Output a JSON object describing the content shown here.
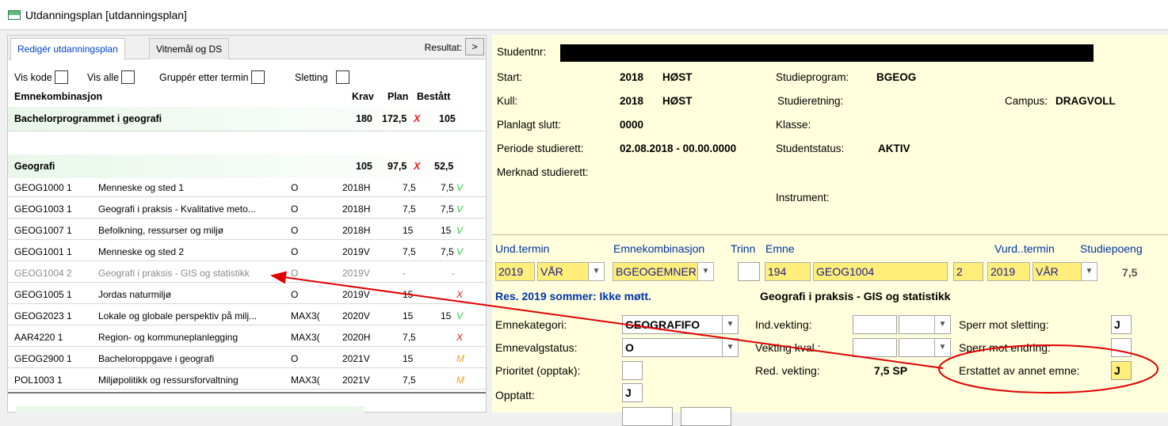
{
  "window": {
    "title": "Utdanningsplan  [utdanningsplan]"
  },
  "tabs": [
    {
      "label": "Redigér utdanningsplan"
    },
    {
      "label": "Vitnemål og DS"
    }
  ],
  "result": {
    "label": "Resultat:",
    "button": ">"
  },
  "checkboxes": [
    {
      "label": "Vis kode"
    },
    {
      "label": "Vis alle"
    },
    {
      "label": "Gruppér etter termin"
    },
    {
      "label": "Sletting"
    }
  ],
  "columns": {
    "name": "Emnekombinasjon",
    "krav": "Krav",
    "plan": "Plan",
    "bestatt": "Bestått"
  },
  "groups": [
    {
      "name": "Bachelorprogrammet i geografi",
      "krav": "180",
      "plan": "172,5",
      "mark": "X",
      "bestatt": "105"
    },
    {
      "name": "Geografi",
      "krav": "105",
      "plan": "97,5",
      "mark": "X",
      "bestatt": "52,5"
    }
  ],
  "rows": [
    {
      "code": "GEOG1000 1",
      "name": "Menneske og sted 1",
      "type": "O",
      "term": "2018H",
      "sp": "7,5",
      "res": "7,5",
      "mark": "V"
    },
    {
      "code": "GEOG1003 1",
      "name": "Geografi i praksis - Kvalitative meto...",
      "type": "O",
      "term": "2018H",
      "sp": "7,5",
      "res": "7,5",
      "mark": "V"
    },
    {
      "code": "GEOG1007 1",
      "name": "Befolkning, ressurser og miljø",
      "type": "O",
      "term": "2018H",
      "sp": "15",
      "res": "15",
      "mark": "V"
    },
    {
      "code": "GEOG1001 1",
      "name": "Menneske og sted 2",
      "type": "O",
      "term": "2019V",
      "sp": "7,5",
      "res": "7,5",
      "mark": "V"
    },
    {
      "code": "GEOG1004 2",
      "name": "Geografi i praksis - GIS og statistikk",
      "type": "O",
      "term": "2019V",
      "sp": "-",
      "res": "-",
      "mark": ""
    },
    {
      "code": "GEOG1005 1",
      "name": "Jordas naturmiljø",
      "type": "O",
      "term": "2019V",
      "sp": "15",
      "res": "",
      "mark": "X"
    },
    {
      "code": "GEOG2023 1",
      "name": "Lokale og globale perspektiv på milj...",
      "type": "MAX3(",
      "term": "2020V",
      "sp": "15",
      "res": "15",
      "mark": "V"
    },
    {
      "code": "AAR4220 1",
      "name": "Region- og kommuneplanlegging",
      "type": "MAX3(",
      "term": "2020H",
      "sp": "7,5",
      "res": "",
      "mark": "X"
    },
    {
      "code": "GEOG2900 1",
      "name": "Bacheloroppgave i geografi",
      "type": "O",
      "term": "2021V",
      "sp": "15",
      "res": "",
      "mark": "M"
    },
    {
      "code": "POL1003 1",
      "name": "Miljøpolitikk og ressursforvaltning",
      "type": "MAX3(",
      "term": "2021V",
      "sp": "7,5",
      "res": "",
      "mark": "M"
    }
  ],
  "student": {
    "studentnr_label": "Studentnr:",
    "start_label": "Start:",
    "start_year": "2018",
    "start_term": "HØST",
    "kull_label": "Kull:",
    "kull_year": "2018",
    "kull_term": "HØST",
    "slutt_label": "Planlagt slutt:",
    "slutt_value": "0000",
    "periode_label": "Periode studierett:",
    "periode_value": "02.08.2018 - 00.00.0000",
    "merknad_label": "Merknad studierett:",
    "program_label": "Studieprogram:",
    "program_value": "BGEOG",
    "retning_label": "Studieretning:",
    "campus_label": "Campus:",
    "campus_value": "DRAGVOLL",
    "klasse_label": "Klasse:",
    "status_label": "Studentstatus:",
    "status_value": "AKTIV",
    "instrument_label": "Instrument:"
  },
  "detail": {
    "und_termin_label": "Und.termin",
    "emnekomb_label": "Emnekombinasjon",
    "trinn_label": "Trinn",
    "emne_label": "Emne",
    "vurd_label": "Vurd..termin",
    "sp_label": "Studiepoeng",
    "year": "2019",
    "term": "VÅR",
    "emnekomb": "BGEOGEMNER",
    "nr": "194",
    "emne": "GEOG1004",
    "versjon": "2",
    "vurd_year": "2019",
    "vurd_term": "VÅR",
    "sp": "7,5",
    "result_text": "Res. 2019 sommer: Ikke møtt.",
    "emne_name": "Geografi i praksis - GIS og statistikk",
    "kategori_label": "Emnekategori:",
    "kategori_value": "GEOGRAFIFO",
    "valgstatus_label": "Emnevalgstatus:",
    "valgstatus_value": "O",
    "prioritet_label": "Prioritet (opptak):",
    "opptatt_label": "Opptatt:",
    "opptatt_value": "J",
    "indvekting_label": "Ind.vekting:",
    "vektkval_label": "Vekting kval.:",
    "redvekting_label": "Red. vekting:",
    "redvekting_value": "7,5 SP",
    "sperr_slett_label": "Sperr mot sletting:",
    "sperr_slett_value": "J",
    "sperr_endring_label": "Sperr mot endring:",
    "erstattet_label": "Erstattet av annet emne:",
    "erstattet_value": "J"
  },
  "colors": {
    "annotation": "#e00000",
    "highlight": "#ffef7a",
    "panel": "#ffffdd"
  }
}
